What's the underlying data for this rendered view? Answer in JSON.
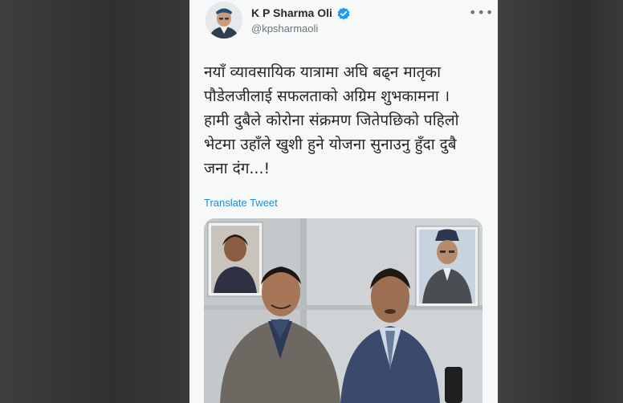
{
  "tweet": {
    "author_name": "K P Sharma Oli",
    "handle": "@kpsharmaoli",
    "verified": true,
    "more_icon": "ellipsis-icon",
    "text_lines": [
      "नयाँ व्यावसायिक यात्रामा अघि बढ्न मातृका",
      "पौडेलजीलाई सफलताको अग्रिम शुभकामना ।",
      "हामी दुबैले कोरोना संक्रमण जितेपछिको पहिलो",
      "भेटमा उहाँले खुशी हुने योजना सुनाउनु हुँदा दुबै",
      "जना दंग...!"
    ],
    "translate_label": "Translate Tweet"
  },
  "colors": {
    "accent": "#1d8cd8",
    "verified_badge": "#1d9bf0",
    "card_bg": "#f7f8f8"
  }
}
